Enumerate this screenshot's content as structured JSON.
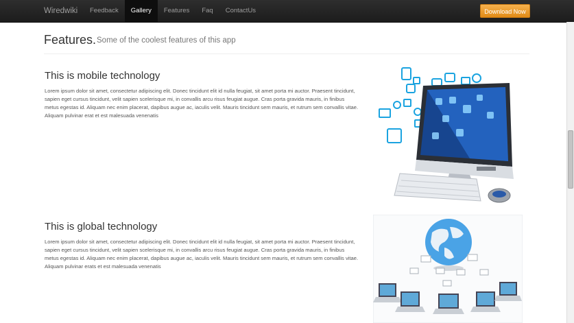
{
  "navbar": {
    "brand": "Wiredwiki",
    "items": [
      {
        "label": "Feedback",
        "active": false
      },
      {
        "label": "Gallery",
        "active": true
      },
      {
        "label": "Features",
        "active": false
      },
      {
        "label": "Faq",
        "active": false
      },
      {
        "label": "ContactUs",
        "active": false
      }
    ],
    "download_label": "Download Now",
    "active_color": "#0e0e0e",
    "button_color": "#f0a030"
  },
  "header": {
    "title": "Features.",
    "subtitle": "Some of the coolest features of this app"
  },
  "features": [
    {
      "title": "This is mobile technology",
      "text": "Lorem ipsum dolor sit amet, consectetur adipiscing elit. Donec tincidunt elit id nulla feugiat, sit amet porta mi auctor. Praesent tincidunt, sapien eget cursus tincidunt, velit sapien scelerisque mi, in convallis arcu risus feugiat augue. Cras porta gravida mauris, in finibus metus egestas id. Aliquam nec enim placerat, dapibus augue ac, iaculis velit. Mauris tincidunt sem mauris, et rutrum sem convallis vitae. Aliquam pulvinar erat et est malesuada venenatis",
      "image": "computer-with-app-icons-illustration"
    },
    {
      "title": "This is global technology",
      "text": "Lorem ipsum dolor sit amet, consectetur adipiscing elit. Donec tincidunt elit id nulla feugiat, sit amet porta mi auctor. Praesent tincidunt, sapien eget cursus tincidunt, velit sapien scelerisque mi, in convallis arcu risus feugiat augue. Cras porta gravida mauris, in finibus metus egestas id. Aliquam nec enim placerat, dapibus augue ac, iaculis velit. Mauris tincidunt sem mauris, et rutrum sem convallis vitae. Aliquam pulvinar erats et est malesuada venenatis",
      "image": "globe-with-laptops-illustration"
    }
  ]
}
